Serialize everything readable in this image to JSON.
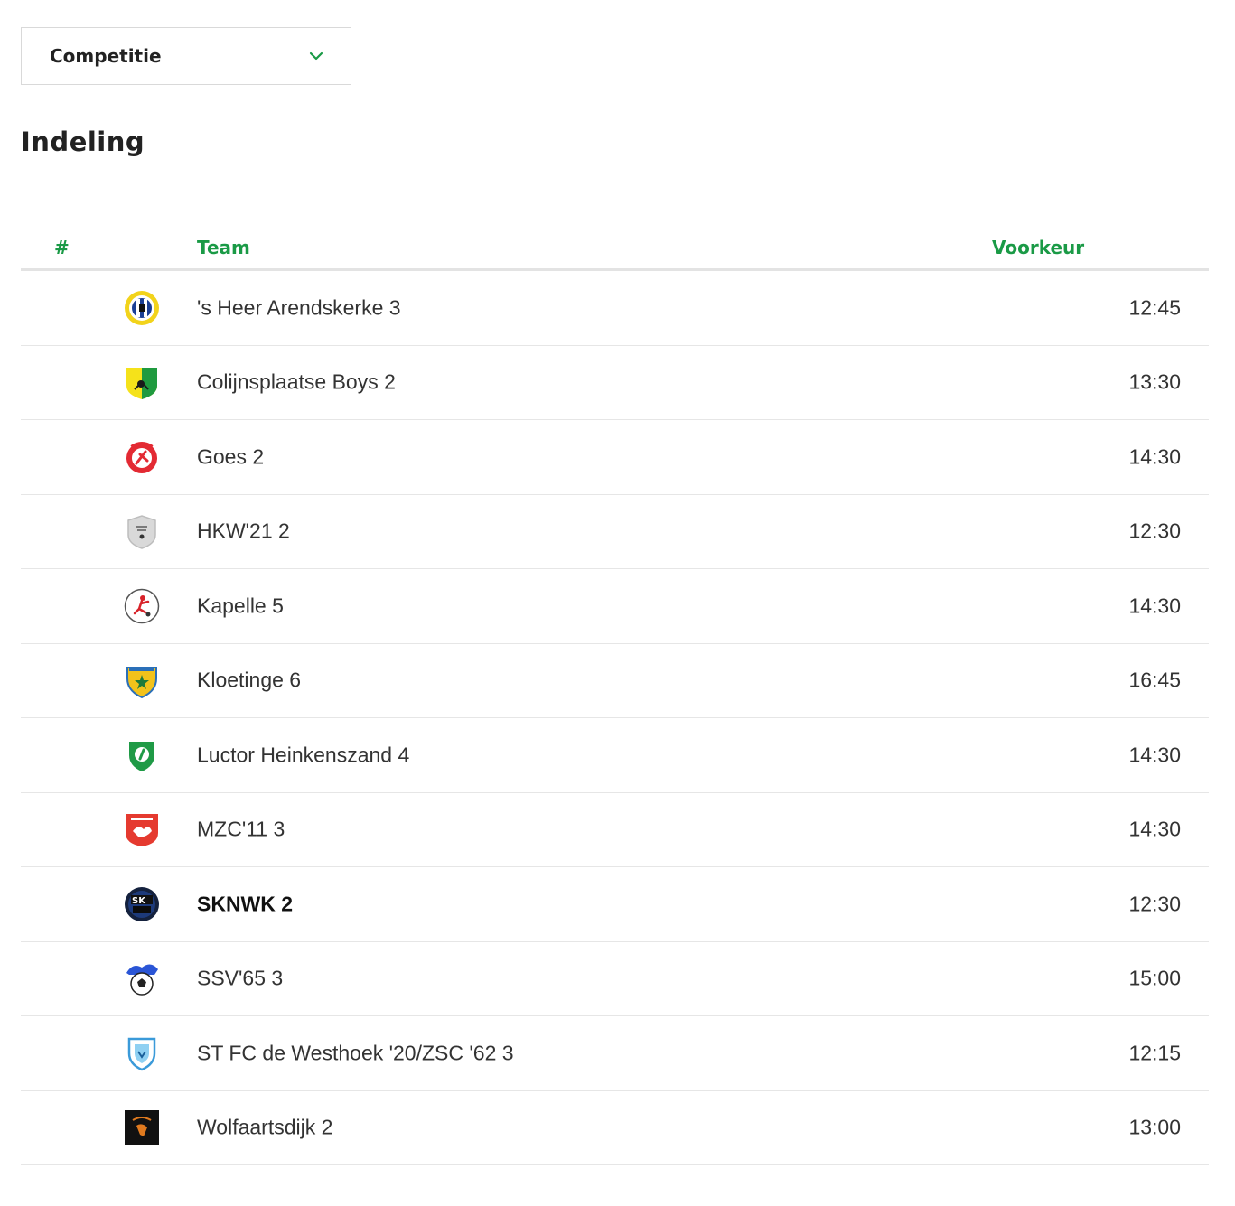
{
  "filter": {
    "label": "Competitie",
    "icon": "chevron-down-icon"
  },
  "page_title": "Indeling",
  "table": {
    "headers": {
      "rank": "#",
      "team": "Team",
      "preference": "Voorkeur"
    },
    "rows": [
      {
        "team": "'s Heer Arendskerke 3",
        "preference": "12:45",
        "logo": "sha-logo-icon",
        "own": false
      },
      {
        "team": "Colijnsplaatse Boys 2",
        "preference": "13:30",
        "logo": "colijnsplaatse-logo-icon",
        "own": false
      },
      {
        "team": "Goes 2",
        "preference": "14:30",
        "logo": "goes-logo-icon",
        "own": false
      },
      {
        "team": "HKW'21 2",
        "preference": "12:30",
        "logo": "no-logo-shield-icon",
        "own": false
      },
      {
        "team": "Kapelle 5",
        "preference": "14:30",
        "logo": "kapelle-logo-icon",
        "own": false
      },
      {
        "team": "Kloetinge 6",
        "preference": "16:45",
        "logo": "kloetinge-logo-icon",
        "own": false
      },
      {
        "team": "Luctor Heinkenszand 4",
        "preference": "14:30",
        "logo": "luctor-logo-icon",
        "own": false
      },
      {
        "team": "MZC'11 3",
        "preference": "14:30",
        "logo": "mzc-logo-icon",
        "own": false
      },
      {
        "team": "SKNWK 2",
        "preference": "12:30",
        "logo": "sknwk-logo-icon",
        "own": true
      },
      {
        "team": "SSV'65 3",
        "preference": "15:00",
        "logo": "ssv-logo-icon",
        "own": false
      },
      {
        "team": "ST FC de Westhoek '20/ZSC '62 3",
        "preference": "12:15",
        "logo": "westhoek-logo-icon",
        "own": false
      },
      {
        "team": "Wolfaartsdijk 2",
        "preference": "13:00",
        "logo": "wolfaartsdijk-logo-icon",
        "own": false
      }
    ]
  },
  "colors": {
    "accent": "#1a9a46",
    "divider": "#e6e6e6"
  }
}
